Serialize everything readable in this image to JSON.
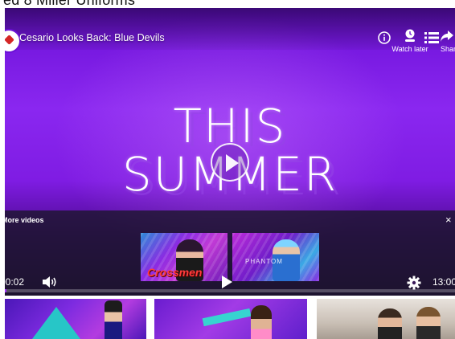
{
  "page": {
    "title": "ed 8 Miller Uniforms"
  },
  "player": {
    "video_title": "Cesario Looks Back: Blue Devils",
    "headline_line_1": "THIS",
    "headline_line_2": "SUMMER",
    "actions": {
      "info_icon": "info-icon",
      "watch_later_label": "Watch later",
      "watch_later_icon": "clock-icon",
      "playlist_icon": "playlist-icon",
      "share_label": "Shar",
      "share_icon": "share-icon"
    },
    "more_videos": {
      "label": "More videos",
      "close_symbol": "×",
      "suggestions": [
        {
          "caption": "Crossmen",
          "subcaption": ""
        },
        {
          "caption": "",
          "subcaption": "PHANTOM"
        }
      ]
    },
    "controls": {
      "time_current": "00:02",
      "time_total": "13:00",
      "progress_fraction": 0.003,
      "volume_icon": "volume-icon",
      "play_icon": "play-icon",
      "settings_icon": "gear-icon"
    },
    "colors": {
      "accent": "#a233ff",
      "background_purple": "#7f1ce3"
    }
  },
  "thumbnails": [
    {
      "name": "thumbnail-1"
    },
    {
      "name": "thumbnail-2"
    },
    {
      "name": "thumbnail-3"
    }
  ]
}
